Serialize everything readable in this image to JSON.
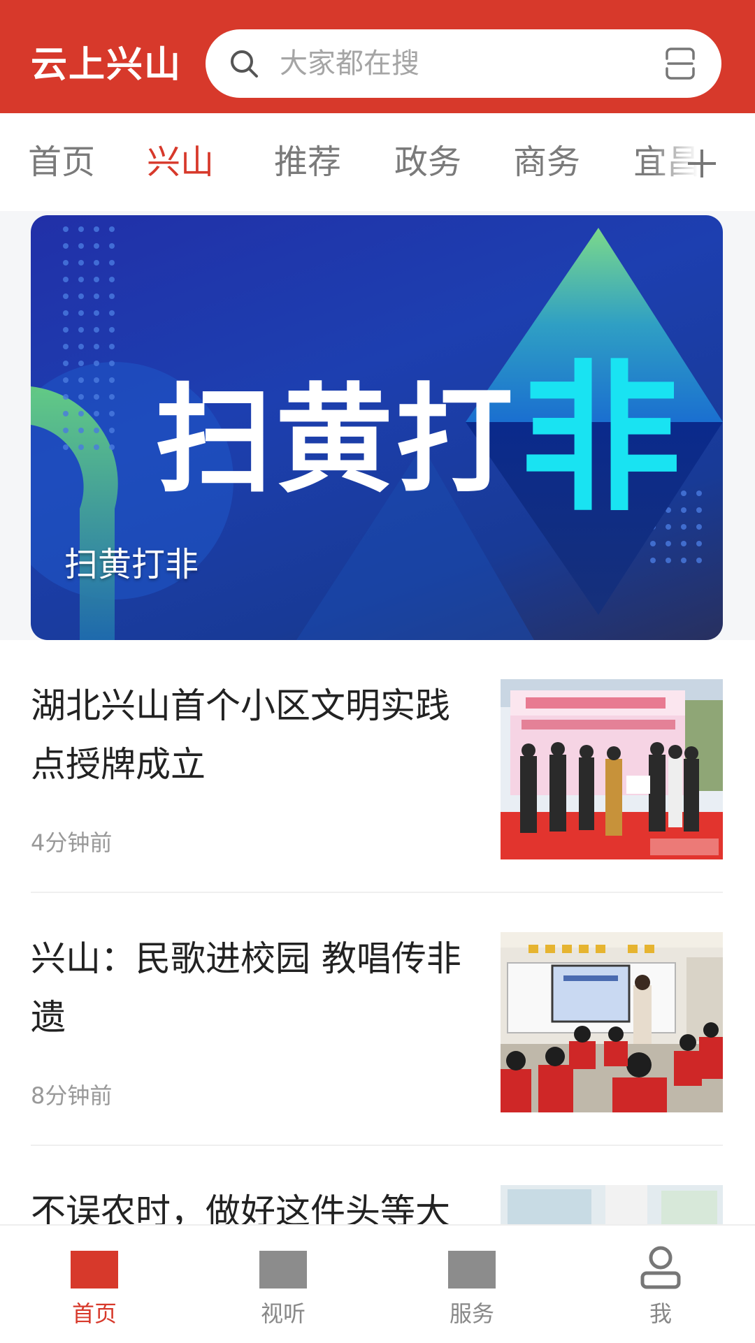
{
  "header": {
    "app_title": "云上兴山",
    "search_placeholder": "大家都在搜",
    "search_icon": "search-icon",
    "scan_icon": "scan-icon",
    "background_color": "#d7392b"
  },
  "tabs": {
    "items": [
      {
        "label": "首页",
        "active": false
      },
      {
        "label": "兴山",
        "active": true
      },
      {
        "label": "推荐",
        "active": false
      },
      {
        "label": "政务",
        "active": false
      },
      {
        "label": "商务",
        "active": false
      },
      {
        "label": "宜昌",
        "active": false
      }
    ],
    "add_icon": "plus-icon",
    "active_color": "#d7392b"
  },
  "banner": {
    "headline": "扫黄打非",
    "caption": "扫黄打非"
  },
  "news": [
    {
      "title": "湖北兴山首个小区文明实践点授牌成立",
      "time": "4分钟前"
    },
    {
      "title": "兴山：民歌进校园 教唱传非遗",
      "time": "8分钟前"
    },
    {
      "title": "不误农时，做好这件头等大",
      "time": ""
    }
  ],
  "bottom_nav": {
    "items": [
      {
        "label": "首页",
        "icon": "home-icon",
        "active": true
      },
      {
        "label": "视听",
        "icon": "media-icon",
        "active": false
      },
      {
        "label": "服务",
        "icon": "service-icon",
        "active": false
      },
      {
        "label": "我",
        "icon": "user-icon",
        "active": false
      }
    ]
  }
}
